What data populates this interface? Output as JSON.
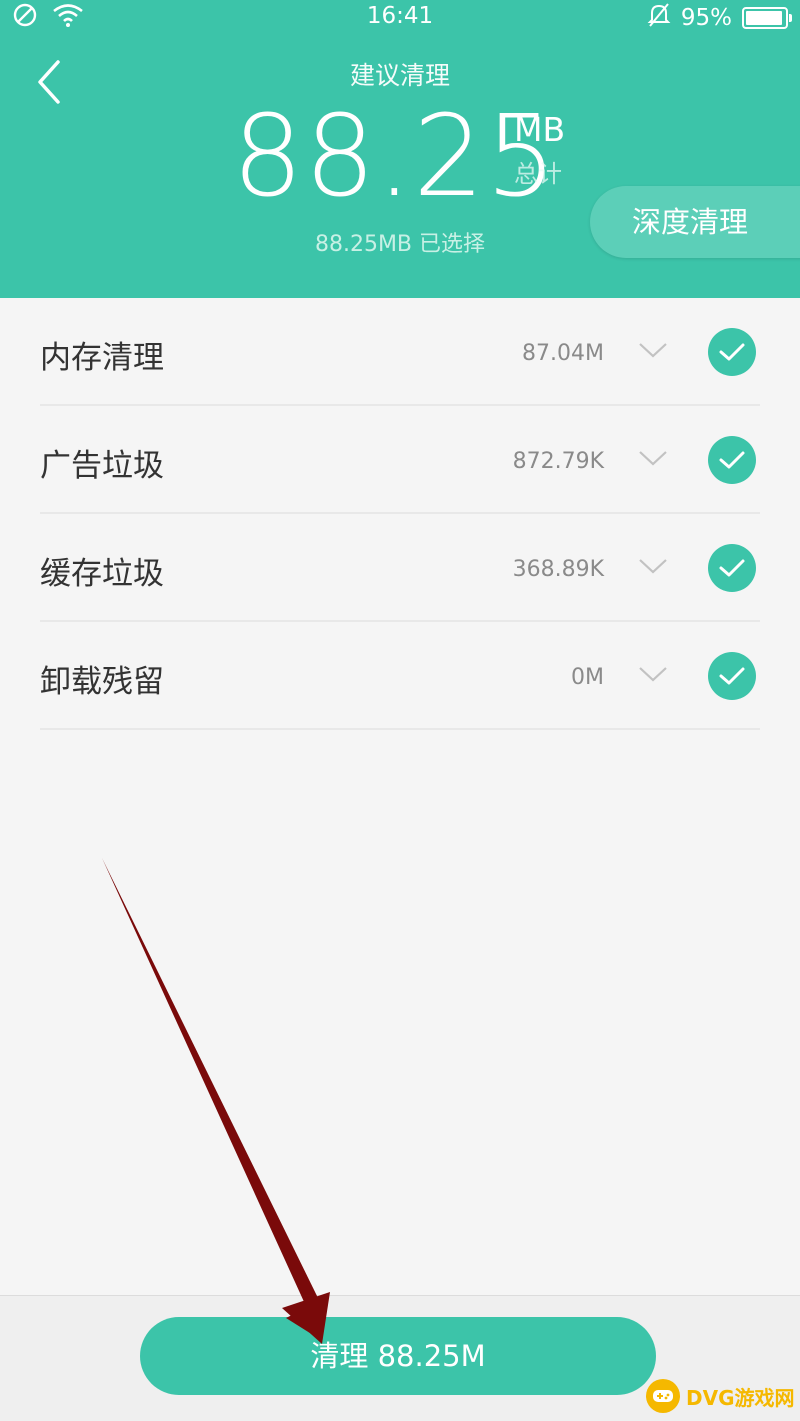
{
  "status_bar": {
    "time": "16:41",
    "battery": "95%",
    "battery_level": 0.95,
    "icons": [
      "no-sim-icon",
      "wifi-icon",
      "mute-bell-icon",
      "battery-icon"
    ]
  },
  "header": {
    "title": "建议清理",
    "total_value": "88.25",
    "total_unit": "MB",
    "total_label": "总计",
    "selected_text": "88.25MB 已选择",
    "deep_clean_label": "深度清理",
    "accent_color": "#3cc4a9"
  },
  "items": [
    {
      "label": "内存清理",
      "size": "87.04M",
      "checked": true
    },
    {
      "label": "广告垃圾",
      "size": "872.79K",
      "checked": true
    },
    {
      "label": "缓存垃圾",
      "size": "368.89K",
      "checked": true
    },
    {
      "label": "卸载残留",
      "size": "0M",
      "checked": true
    }
  ],
  "footer": {
    "clean_button_label": "清理 88.25M"
  },
  "watermark": {
    "text": "DVG游戏网"
  }
}
